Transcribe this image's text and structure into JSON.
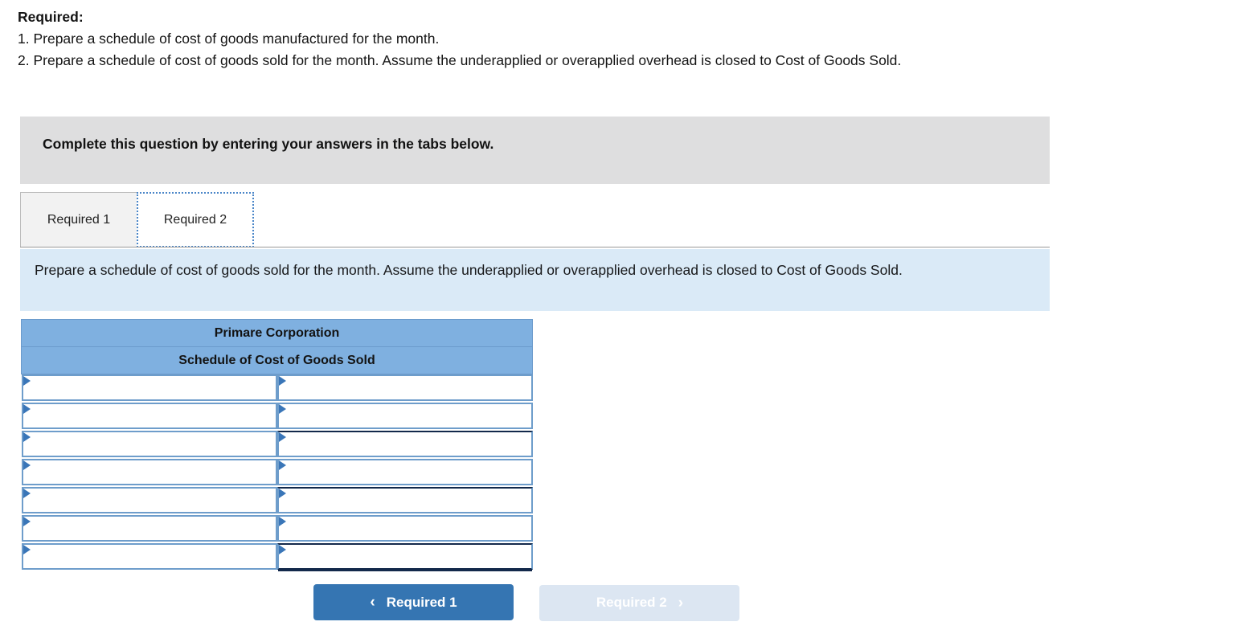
{
  "intro": {
    "heading": "Required:",
    "line1": "1. Prepare a schedule of cost of goods manufactured for the month.",
    "line2": "2. Prepare a schedule of cost of goods sold for the month. Assume the underapplied or overapplied overhead is closed to Cost of Goods Sold."
  },
  "banner": {
    "text": "Complete this question by entering your answers in the tabs below."
  },
  "tabs": [
    {
      "label": "Required 1",
      "active": false
    },
    {
      "label": "Required 2",
      "active": true
    }
  ],
  "instruction": {
    "text": "Prepare a schedule of cost of goods sold for the month. Assume the underapplied or overapplied overhead is closed to Cost of Goods Sold."
  },
  "table": {
    "title": "Primare Corporation",
    "subtitle": "Schedule of Cost of Goods Sold",
    "rows": [
      {
        "label": "",
        "amount": "",
        "label_placeholder": "",
        "amount_placeholder": ""
      },
      {
        "label": "",
        "amount": "",
        "label_placeholder": "",
        "amount_placeholder": ""
      },
      {
        "label": "",
        "amount": "",
        "label_placeholder": "",
        "amount_placeholder": ""
      },
      {
        "label": "",
        "amount": "",
        "label_placeholder": "",
        "amount_placeholder": ""
      },
      {
        "label": "",
        "amount": "",
        "label_placeholder": "",
        "amount_placeholder": ""
      },
      {
        "label": "",
        "amount": "",
        "label_placeholder": "",
        "amount_placeholder": ""
      },
      {
        "label": "",
        "amount": "",
        "label_placeholder": "",
        "amount_placeholder": ""
      }
    ]
  },
  "nav": {
    "prev_label": "Required 1",
    "prev_chevron": "‹",
    "next_label": "Required 2",
    "next_chevron": "›"
  },
  "colors": {
    "header_blue": "#7fb0e0",
    "cell_border_blue": "#6e9dcb",
    "instruction_bg": "#daeaf7",
    "banner_gray": "#dededf",
    "button_primary": "#3575b2",
    "button_disabled": "#dce6f2",
    "rule_dark": "#13294b"
  }
}
